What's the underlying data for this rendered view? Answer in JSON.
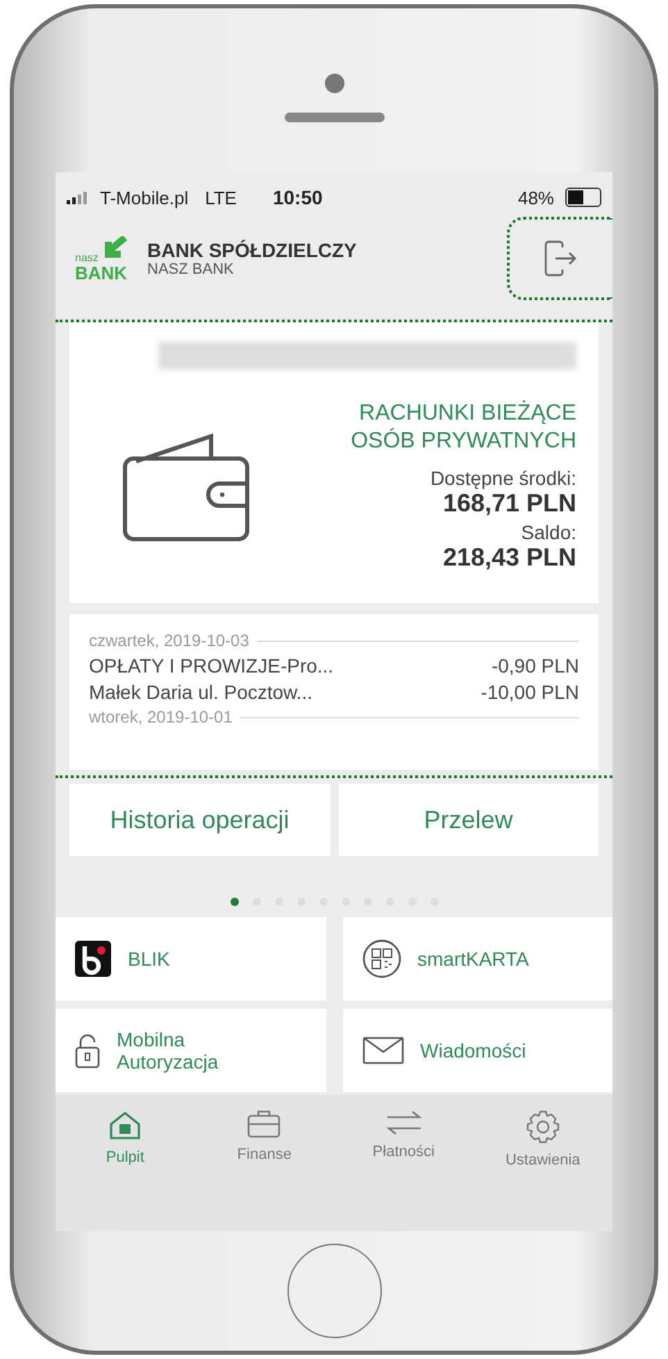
{
  "status_bar": {
    "carrier": "T-Mobile.pl",
    "network": "LTE",
    "time": "10:50",
    "battery_text": "48%"
  },
  "header": {
    "bank_logo_top": "nasz",
    "bank_logo_bottom": "BANK",
    "title": "BANK SPÓŁDZIELCZY",
    "subtitle": "NASZ BANK",
    "logout_highlighted": true
  },
  "account": {
    "highlighted": true,
    "type_line_1": "RACHUNKI BIEŻĄCE",
    "type_line_2": "OSÓB PRYWATNYCH",
    "available_label": "Dostępne środki:",
    "available": "168,71 PLN",
    "balance_label": "Saldo:",
    "balance": "218,43 PLN",
    "history": [
      {
        "date": "czwartek, 2019-10-03",
        "items": [
          {
            "title": "OPŁATY I PROWIZJE-Pro...",
            "amount": "-0,90 PLN"
          },
          {
            "title": "Małek Daria  ul. Pocztow...",
            "amount": "-10,00 PLN"
          }
        ]
      },
      {
        "date": "wtorek, 2019-10-01"
      }
    ]
  },
  "actions": [
    "Historia operacji",
    "Przelew"
  ],
  "pages": [
    {
      "selected": true
    },
    {
      "selected": false
    },
    {
      "selected": false
    },
    {
      "selected": false
    },
    {
      "selected": false
    },
    {
      "selected": false
    },
    {
      "selected": false
    },
    {
      "selected": false
    },
    {
      "selected": false
    },
    {
      "selected": false
    }
  ],
  "tiles": [
    {
      "kind": "blik",
      "label": "BLIK"
    },
    {
      "kind": "qr",
      "label": "smartKARTA"
    },
    {
      "kind": "lock",
      "label": "Mobilna Autoryzacja"
    },
    {
      "kind": "mail",
      "label": "Wiadomości"
    }
  ],
  "tab_bar": [
    {
      "kind": "home",
      "label": "Pulpit",
      "selected": true
    },
    {
      "kind": "briefcase",
      "label": "Finanse",
      "selected": false
    },
    {
      "kind": "transfer",
      "label": "Płatności",
      "selected": false
    },
    {
      "kind": "gear",
      "label": "Ustawienia",
      "selected": false
    }
  ]
}
